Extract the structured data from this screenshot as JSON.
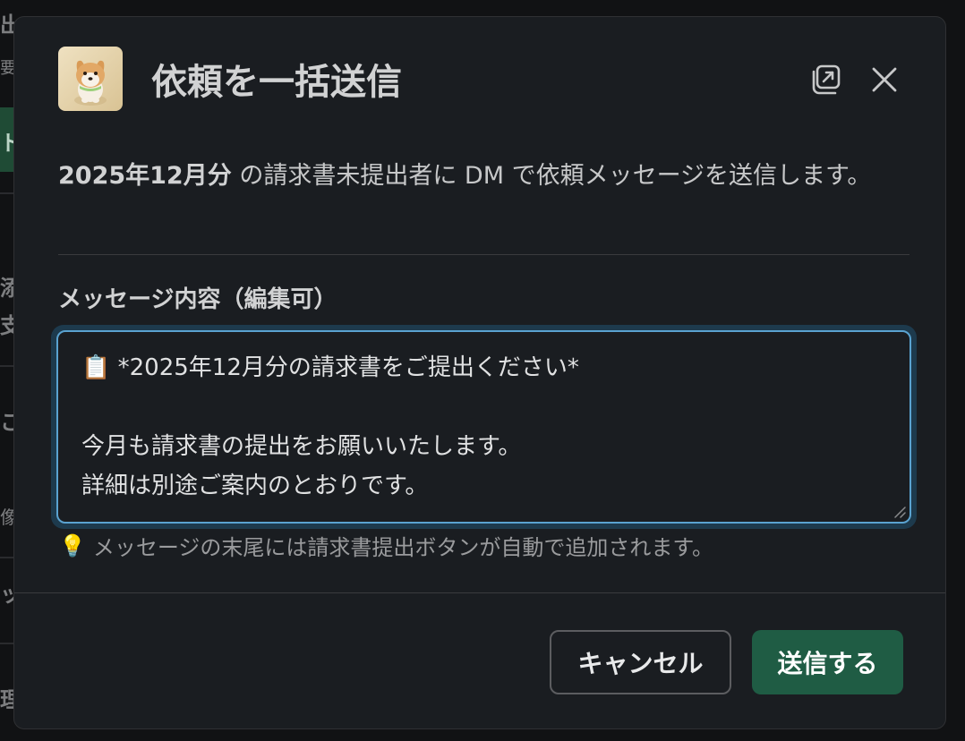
{
  "background": {
    "fragments": [
      "出",
      "要",
      "ト",
      "添",
      "支",
      "こ",
      "像",
      "ット",
      "理"
    ]
  },
  "modal": {
    "title": "依頼を一括送信",
    "avatar_icon": "shiba-dog-avatar",
    "popout_icon": "open-in-new-window-icon",
    "close_icon": "close-icon",
    "description_bold": "2025年12月分",
    "description_rest": " の請求書未提出者に DM で依頼メッセージを送信します。",
    "field_label": "メッセージ内容（編集可）",
    "message_lines": [
      "📋 *2025年12月分の請求書をご提出ください*",
      "",
      "今月も請求書の提出をお願いいたします。",
      "詳細は別途ご案内のとおりです。"
    ],
    "hint_icon": "💡",
    "hint_text": "メッセージの末尾には請求書提出ボタンが自動で追加されます。",
    "cancel_label": "キャンセル",
    "send_label": "送信する"
  },
  "colors": {
    "modal_bg": "#1a1d21",
    "focus_ring": "#5aa2d0",
    "send_button": "#1f5c44"
  }
}
